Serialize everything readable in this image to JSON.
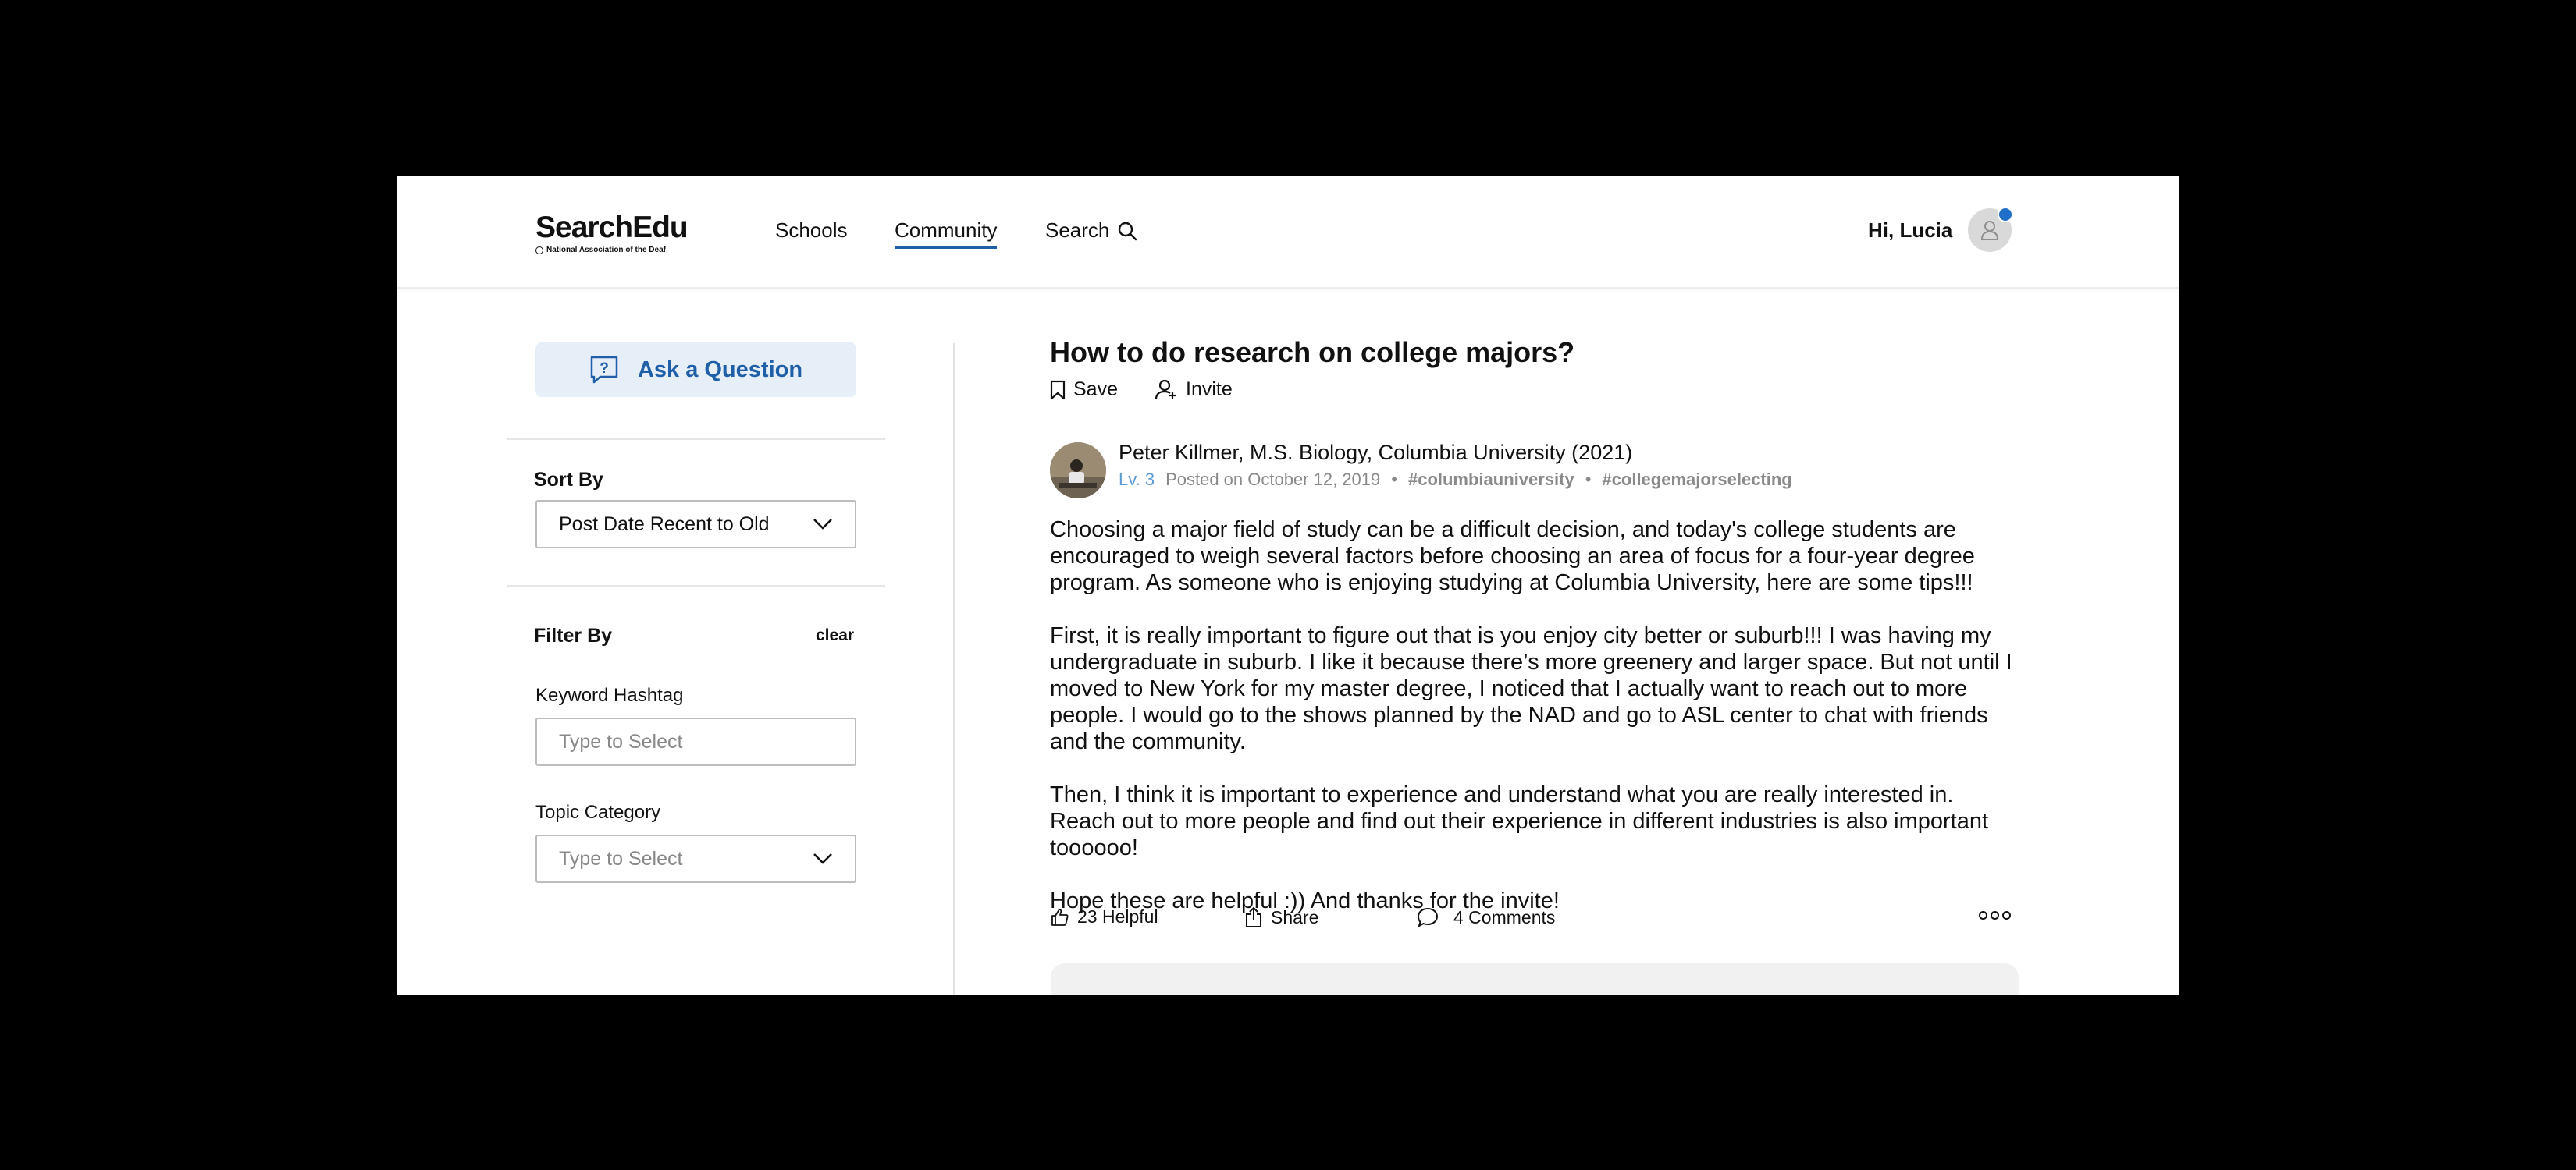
{
  "header": {
    "logo": {
      "name": "SearchEdu",
      "subtitle": "National Association of the Deaf"
    },
    "nav": {
      "schools": "Schools",
      "community": "Community",
      "search": "Search"
    },
    "greeting": "Hi, Lucia"
  },
  "sidebar": {
    "ask_button": "Ask a Question",
    "sort_by_label": "Sort By",
    "sort_value": "Post Date Recent to Old",
    "filter_by_label": "Filter By",
    "clear_label": "clear",
    "keyword_label": "Keyword Hashtag",
    "keyword_placeholder": "Type to Select",
    "topic_label": "Topic Category",
    "topic_placeholder": "Type to Select"
  },
  "post": {
    "title": "How to do research on college majors?",
    "save_label": "Save",
    "invite_label": "Invite",
    "author": "Peter Killmer, M.S. Biology, Columbia University (2021)",
    "level": "Lv. 3",
    "posted": "Posted on October 12, 2019",
    "tags": [
      "#columbiauniversity",
      "#collegemajorselecting"
    ],
    "paragraphs": [
      "Choosing a major field of study can be a difficult decision, and today's college students are encouraged to weigh several factors before choosing an area of focus for a four-year degree program. As someone who is enjoying studying at Columbia University, here are some tips!!!",
      "First, it is really important to figure out that is you enjoy city better or suburb!!! I was having my undergraduate in suburb. I like it because there’s more greenery and larger space. But not until I moved to New York for my master degree, I noticed that I actually want to reach out to more people. I would go to the shows planned by the NAD and go to ASL center to chat with friends and the community.",
      "Then, I think it is important to experience and understand what you are really interested in. Reach out to more people and find out their experience in different industries is also important toooooo!",
      "Hope these are helpful :)) And thanks for the invite!"
    ],
    "helpful_label": "23 Helpful",
    "share_label": "Share",
    "comments_label": "4 Comments"
  },
  "colors": {
    "accent": "#1f5fa8",
    "ask_bg": "#e6eff8",
    "notification": "#1f6fc8"
  }
}
